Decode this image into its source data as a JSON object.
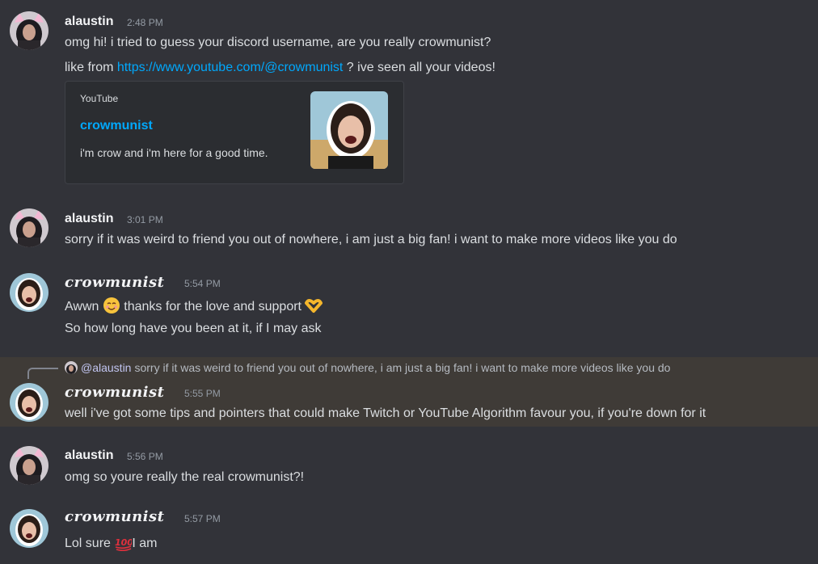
{
  "users": {
    "alaustin": "alaustin",
    "crowmunist": "crowmunist"
  },
  "messages": [
    {
      "author": "alaustin",
      "time": "2:48 PM",
      "lines": [
        "omg hi! i tried to guess your discord username, are you really crowmunist?",
        {
          "before": "like from ",
          "link": "https://www.youtube.com/@crowmunist",
          "after": " ? ive seen all your videos!"
        }
      ],
      "embed": {
        "provider": "YouTube",
        "title": "crowmunist",
        "description": "i'm crow and i'm here for a good time."
      }
    },
    {
      "author": "alaustin",
      "time": "3:01 PM",
      "lines": [
        "sorry if it was weird to friend you out of nowhere, i am just a big fan! i want to make more videos like you do"
      ]
    },
    {
      "author": "crowmunist",
      "time": "5:54 PM",
      "lines": [
        {
          "before": "Awwn ",
          "emoji1": "smiling-face-emoji",
          "middle": " thanks for the love and support ",
          "emoji2": "heart-hands-emoji"
        },
        "So how long have you been at it, if I may ask"
      ]
    },
    {
      "author": "crowmunist",
      "time": "5:55 PM",
      "reply": {
        "mention": "@alaustin",
        "text": "sorry if it was weird to friend you out of nowhere, i am just a big fan! i want to make more videos like you do"
      },
      "lines": [
        "well i've got some tips and pointers that could make Twitch or YouTube Algorithm favour you, if you're down for it"
      ]
    },
    {
      "author": "alaustin",
      "time": "5:56 PM",
      "lines": [
        "omg so youre really the real crowmunist?!"
      ]
    },
    {
      "author": "crowmunist",
      "time": "5:57 PM",
      "lines": [
        {
          "before": "Lol sure ",
          "emoji": "hundred-points-emoji",
          "after": "I am"
        }
      ]
    }
  ],
  "colors": {
    "background": "#323339",
    "link": "#00a8fc",
    "timestamp": "#949ba4",
    "reply_highlight": "#3f3b37"
  }
}
